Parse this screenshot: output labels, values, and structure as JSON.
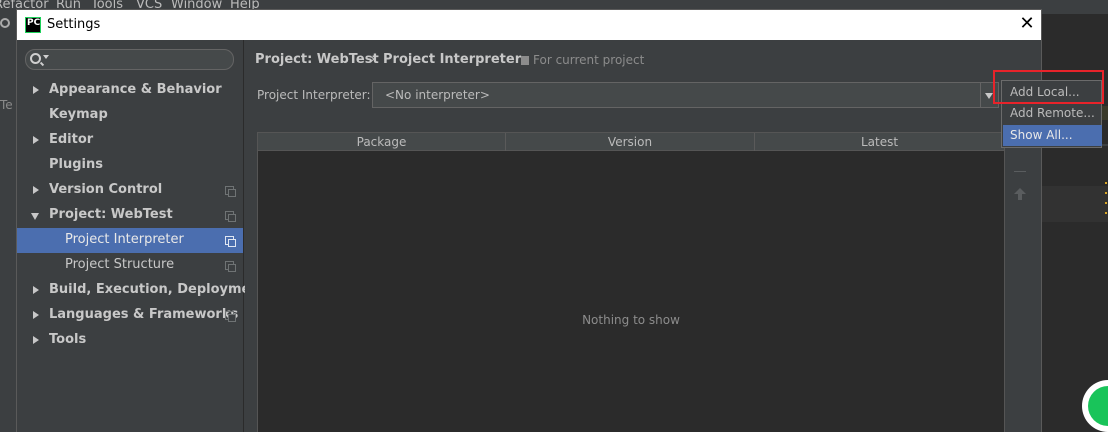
{
  "ide": {
    "menus": [
      "Refactor",
      "Run",
      "Tools",
      "VCS",
      "Window",
      "Help"
    ],
    "left_fragment": "Te"
  },
  "dialog": {
    "title": "Settings",
    "app_icon_text": "PC"
  },
  "sidebar": {
    "search_placeholder": "",
    "items": [
      {
        "label": "Appearance & Behavior"
      },
      {
        "label": "Keymap"
      },
      {
        "label": "Editor"
      },
      {
        "label": "Plugins"
      },
      {
        "label": "Version Control"
      },
      {
        "label": "Project: WebTest"
      },
      {
        "label": "Project Interpreter"
      },
      {
        "label": "Project Structure"
      },
      {
        "label": "Build, Execution, Deployment"
      },
      {
        "label": "Languages & Frameworks"
      },
      {
        "label": "Tools"
      }
    ]
  },
  "main": {
    "breadcrumb": {
      "parent": "Project: WebTest",
      "separator": "›",
      "current": "Project Interpreter"
    },
    "scope_note": "For current project",
    "interpreter_label": "Project Interpreter:",
    "interpreter_value": "<No interpreter>",
    "table": {
      "columns": [
        "Package",
        "Version",
        "Latest"
      ],
      "empty_text": "Nothing to show"
    }
  },
  "popup": {
    "items": [
      "Add Local...",
      "Add Remote...",
      "Show All..."
    ]
  },
  "colors": {
    "selection": "#4b6eaf",
    "dialog_bg": "#3c3f41",
    "highlight_border": "#e8232a"
  }
}
